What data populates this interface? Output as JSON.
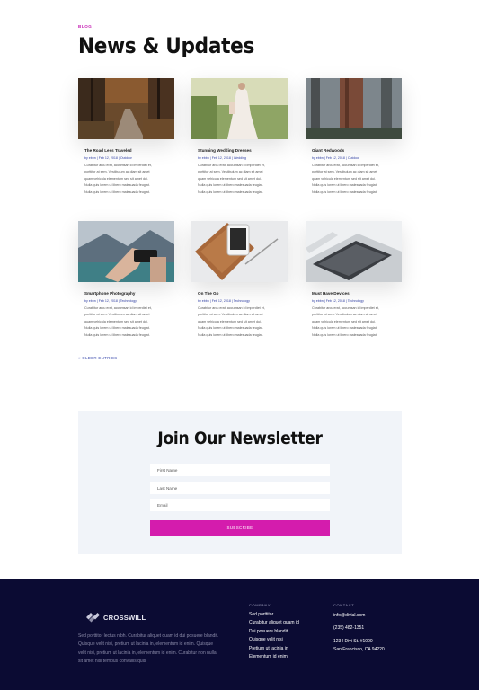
{
  "header": {
    "eyebrow": "BLOG",
    "title": "News & Updates"
  },
  "posts": [
    {
      "title": "The Road Less Traveled",
      "meta": "by ebbn | Feb 12, 2018 | Outdoor",
      "excerpt": [
        "Curabitur arcu erat, accumsan id imperdiet et,",
        "porttitor at sem. Vestibulum ac diam sit amet",
        "quam vehicula elementum sed sit amet dui.",
        "Nulla quis lorem ut libero malesuada feugiat.",
        "Nulla quis lorem ut libero malesuada feugiat."
      ]
    },
    {
      "title": "Stunning Wedding Dresses",
      "meta": "by ebbn | Feb 12, 2018 | Wedding",
      "excerpt": [
        "Curabitur arcu erat, accumsan id imperdiet et,",
        "porttitor at sem. Vestibulum ac diam sit amet",
        "quam vehicula elementum sed sit amet dui.",
        "Nulla quis lorem ut libero malesuada feugiat.",
        "Nulla quis lorem ut libero malesuada feugiat."
      ]
    },
    {
      "title": "Giant Redwoods",
      "meta": "by ebbn | Feb 12, 2018 | Outdoor",
      "excerpt": [
        "Curabitur arcu erat, accumsan id imperdiet et,",
        "porttitor at sem. Vestibulum ac diam sit amet",
        "quam vehicula elementum sed sit amet dui.",
        "Nulla quis lorem ut libero malesuada feugiat.",
        "Nulla quis lorem ut libero malesuada feugiat."
      ]
    },
    {
      "title": "Smartphone Photography",
      "meta": "by ebbn | Feb 12, 2018 | Technology",
      "excerpt": [
        "Curabitur arcu erat, accumsan id imperdiet et,",
        "porttitor at sem. Vestibulum ac diam sit amet",
        "quam vehicula elementum sed sit amet dui.",
        "Nulla quis lorem ut libero malesuada feugiat.",
        "Nulla quis lorem ut libero malesuada feugiat."
      ]
    },
    {
      "title": "On The Go",
      "meta": "by ebbn | Feb 12, 2018 | Technology",
      "excerpt": [
        "Curabitur arcu erat, accumsan id imperdiet et,",
        "porttitor at sem. Vestibulum ac diam sit amet",
        "quam vehicula elementum sed sit amet dui.",
        "Nulla quis lorem ut libero malesuada feugiat.",
        "Nulla quis lorem ut libero malesuada feugiat."
      ]
    },
    {
      "title": "Must Have Devices",
      "meta": "by ebbn | Feb 12, 2018 | Technology",
      "excerpt": [
        "Curabitur arcu erat, accumsan id imperdiet et,",
        "porttitor at sem. Vestibulum ac diam sit amet",
        "quam vehicula elementum sed sit amet dui.",
        "Nulla quis lorem ut libero malesuada feugiat.",
        "Nulla quis lorem ut libero malesuada feugiat."
      ]
    }
  ],
  "pagination": {
    "older_label": "« OLDER ENTRIES"
  },
  "newsletter": {
    "title": "Join Our Newsletter",
    "first_name_placeholder": "First Name",
    "last_name_placeholder": "Last Name",
    "email_placeholder": "Email",
    "subscribe_label": "SUBSCRIBE"
  },
  "footer": {
    "brand": "CROSSWILL",
    "about": [
      "Sed porttitor lectus nibh. Curabitur aliquet quam id dui posuere blandit.",
      "Quisque velit nisi, pretium ut lacinia in, elementum id enim. Quisque",
      "velit nisi, pretium ut lacinia in, elementum id enim. Curabitur non nulla",
      "sit amet nisl tempus convallis quis"
    ],
    "company_heading": "COMPANY",
    "company_links": [
      "Sed porttitor",
      "Curabitur aliquet quam id",
      "Dui posuere blandit",
      "Quisque velit nisi",
      "Pretium ut lacinia in",
      "Elementum id enim"
    ],
    "contact_heading": "CONTACT",
    "email": "info@divial.com",
    "phone": "(235) 482-1351",
    "address_1": "1234 Divi St. #1000",
    "address_2": "San Francisco, CA 94220"
  },
  "colors": {
    "accent": "#d41cad",
    "link": "#2f3fa5",
    "footer_bg": "#0b0b33",
    "newsletter_bg": "#f1f4f9"
  }
}
